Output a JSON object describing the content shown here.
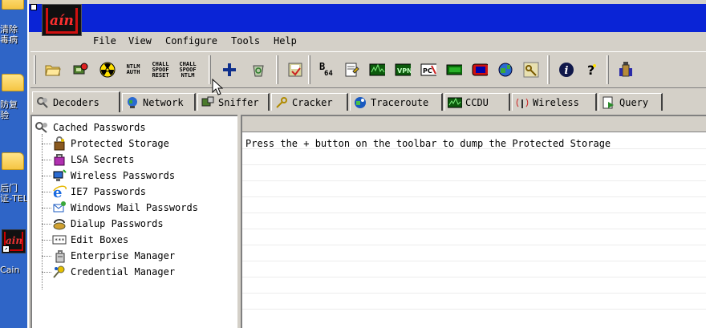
{
  "desktop": {
    "icons": [
      {
        "label": "清除\n毒病"
      },
      {
        "label": "防复\n验"
      },
      {
        "label": "后门\n证-TEL"
      },
      {
        "label": "Cain"
      }
    ]
  },
  "menu": {
    "file": "File",
    "view": "View",
    "configure": "Configure",
    "tools": "Tools",
    "help": "Help"
  },
  "toolbar": {
    "ntlm_auth": "NTLM AUTH",
    "chall_spoof_reset": "CHALL SPOOF RESET",
    "chall_spoof_ntlm": "CHALL SPOOF NTLM",
    "b64_top": "B",
    "b64_sub": "64"
  },
  "tabs": [
    {
      "label": "Decoders",
      "icon": "decoders-icon"
    },
    {
      "label": "Network",
      "icon": "network-icon"
    },
    {
      "label": "Sniffer",
      "icon": "sniffer-icon"
    },
    {
      "label": "Cracker",
      "icon": "cracker-icon"
    },
    {
      "label": "Traceroute",
      "icon": "traceroute-icon"
    },
    {
      "label": "CCDU",
      "icon": "ccdu-icon"
    },
    {
      "label": "Wireless",
      "icon": "wireless-icon"
    },
    {
      "label": "Query",
      "icon": "query-icon"
    }
  ],
  "tree": {
    "root": "Cached Passwords",
    "children": [
      {
        "label": "Protected Storage"
      },
      {
        "label": "LSA Secrets"
      },
      {
        "label": "Wireless Passwords"
      },
      {
        "label": "IE7 Passwords"
      },
      {
        "label": "Windows Mail Passwords"
      },
      {
        "label": "Dialup Passwords"
      },
      {
        "label": "Edit Boxes"
      },
      {
        "label": "Enterprise Manager"
      },
      {
        "label": "Credential Manager"
      }
    ]
  },
  "pane": {
    "message": "Press the + button on the toolbar to dump the Protected Storage"
  },
  "colors": {
    "titlebar": "#0a24d6",
    "face": "#d4d0c8",
    "desktop": "#2f65c7"
  }
}
